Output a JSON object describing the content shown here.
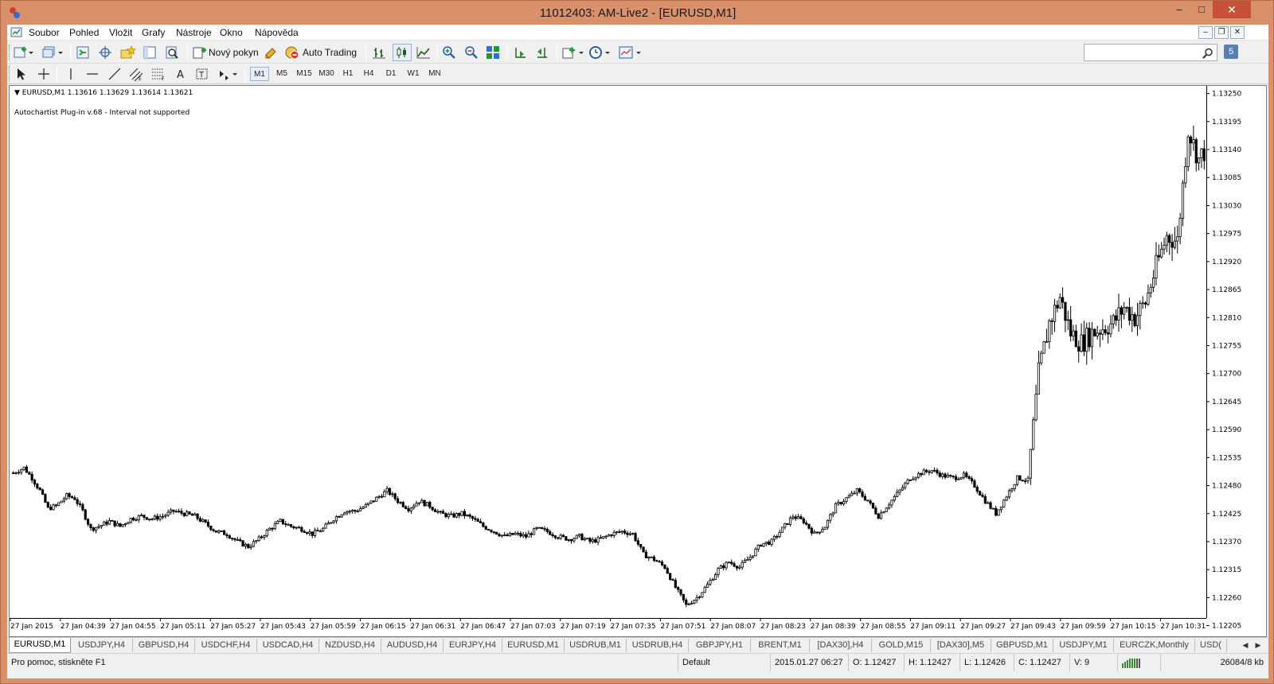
{
  "window": {
    "title": "11012403: AM-Live2 - [EURUSD,M1]",
    "minimize": "–",
    "maximize": "□",
    "close": "✕"
  },
  "menu": {
    "items": [
      "Soubor",
      "Pohled",
      "Vložit",
      "Grafy",
      "Nástroje",
      "Okno",
      "Nápověda"
    ]
  },
  "toolbar": {
    "new_order_label": "Nový pokyn",
    "auto_trading_label": "Auto Trading",
    "search_placeholder": "",
    "notification_count": "5"
  },
  "timeframes": [
    "M1",
    "M5",
    "M15",
    "M30",
    "H1",
    "H4",
    "D1",
    "W1",
    "MN"
  ],
  "active_timeframe": "M1",
  "chart": {
    "symbol_line": "EURUSD,M1  1.13616 1.13629 1.13614 1.13621",
    "plugin_line": "Autochartist Plug-in v.68 - Interval not supported"
  },
  "chart_data": {
    "type": "candlestick",
    "symbol": "EURUSD",
    "timeframe": "M1",
    "ylim": [
      1.1222,
      1.13265
    ],
    "y_ticks": [
      "1.13250",
      "1.13195",
      "1.13140",
      "1.13085",
      "1.13030",
      "1.12975",
      "1.12920",
      "1.12865",
      "1.12810",
      "1.12755",
      "1.12700",
      "1.12645",
      "1.12590",
      "1.12535",
      "1.12480",
      "1.12425",
      "1.12370",
      "1.12315",
      "1.12260",
      "1.12205"
    ],
    "x_ticks": [
      "27 Jan 2015",
      "27 Jan 04:39",
      "27 Jan 04:55",
      "27 Jan 05:11",
      "27 Jan 05:27",
      "27 Jan 05:43",
      "27 Jan 05:59",
      "27 Jan 06:15",
      "27 Jan 06:31",
      "27 Jan 06:47",
      "27 Jan 07:03",
      "27 Jan 07:19",
      "27 Jan 07:35",
      "27 Jan 07:51",
      "27 Jan 08:07",
      "27 Jan 08:23",
      "27 Jan 08:39",
      "27 Jan 08:55",
      "27 Jan 09:11",
      "27 Jan 09:27",
      "27 Jan 09:43",
      "27 Jan 09:59",
      "27 Jan 10:15",
      "27 Jan 10:31"
    ],
    "close_path": [
      [
        0,
        1.12505
      ],
      [
        4,
        1.12515
      ],
      [
        7,
        1.12495
      ],
      [
        10,
        1.1247
      ],
      [
        13,
        1.12435
      ],
      [
        16,
        1.1244
      ],
      [
        20,
        1.1246
      ],
      [
        23,
        1.12455
      ],
      [
        26,
        1.1243
      ],
      [
        29,
        1.12395
      ],
      [
        32,
        1.124
      ],
      [
        36,
        1.1241
      ],
      [
        40,
        1.124
      ],
      [
        44,
        1.12415
      ],
      [
        48,
        1.1242
      ],
      [
        52,
        1.12415
      ],
      [
        56,
        1.1242
      ],
      [
        60,
        1.1243
      ],
      [
        64,
        1.12425
      ],
      [
        68,
        1.1242
      ],
      [
        72,
        1.12405
      ],
      [
        76,
        1.1239
      ],
      [
        80,
        1.12385
      ],
      [
        84,
        1.1237
      ],
      [
        88,
        1.1236
      ],
      [
        92,
        1.12375
      ],
      [
        96,
        1.12395
      ],
      [
        100,
        1.1241
      ],
      [
        104,
        1.124
      ],
      [
        108,
        1.12395
      ],
      [
        112,
        1.12385
      ],
      [
        116,
        1.12395
      ],
      [
        120,
        1.12415
      ],
      [
        124,
        1.1243
      ],
      [
        128,
        1.1243
      ],
      [
        132,
        1.1244
      ],
      [
        136,
        1.12455
      ],
      [
        140,
        1.1247
      ],
      [
        144,
        1.1245
      ],
      [
        148,
        1.12435
      ],
      [
        152,
        1.1245
      ],
      [
        156,
        1.1244
      ],
      [
        160,
        1.12425
      ],
      [
        164,
        1.1242
      ],
      [
        168,
        1.12425
      ],
      [
        172,
        1.12415
      ],
      [
        176,
        1.124
      ],
      [
        180,
        1.1239
      ],
      [
        184,
        1.1238
      ],
      [
        188,
        1.12385
      ],
      [
        192,
        1.1238
      ],
      [
        196,
        1.12395
      ],
      [
        200,
        1.1239
      ],
      [
        204,
        1.1238
      ],
      [
        208,
        1.12375
      ],
      [
        212,
        1.1238
      ],
      [
        216,
        1.1237
      ],
      [
        220,
        1.12375
      ],
      [
        224,
        1.12385
      ],
      [
        228,
        1.1239
      ],
      [
        232,
        1.12385
      ],
      [
        236,
        1.12345
      ],
      [
        240,
        1.12335
      ],
      [
        244,
        1.1232
      ],
      [
        248,
        1.1228
      ],
      [
        252,
        1.12245
      ],
      [
        256,
        1.1226
      ],
      [
        260,
        1.12285
      ],
      [
        264,
        1.12315
      ],
      [
        268,
        1.1233
      ],
      [
        272,
        1.1232
      ],
      [
        276,
        1.1234
      ],
      [
        280,
        1.12365
      ],
      [
        284,
        1.1237
      ],
      [
        288,
        1.12395
      ],
      [
        292,
        1.1242
      ],
      [
        296,
        1.1241
      ],
      [
        300,
        1.12385
      ],
      [
        304,
        1.124
      ],
      [
        308,
        1.1244
      ],
      [
        312,
        1.12455
      ],
      [
        316,
        1.1247
      ],
      [
        320,
        1.1245
      ],
      [
        324,
        1.1242
      ],
      [
        328,
        1.12445
      ],
      [
        332,
        1.1247
      ],
      [
        336,
        1.12495
      ],
      [
        340,
        1.12505
      ],
      [
        344,
        1.1251
      ],
      [
        348,
        1.125
      ],
      [
        352,
        1.12495
      ],
      [
        356,
        1.125
      ],
      [
        360,
        1.1248
      ],
      [
        364,
        1.1245
      ],
      [
        368,
        1.12425
      ],
      [
        372,
        1.1246
      ],
      [
        376,
        1.12495
      ],
      [
        380,
        1.1249
      ],
      [
        384,
        1.127
      ],
      [
        388,
        1.128
      ],
      [
        392,
        1.1285
      ],
      [
        396,
        1.1278
      ],
      [
        400,
        1.1276
      ],
      [
        404,
        1.1278
      ],
      [
        408,
        1.1279
      ],
      [
        412,
        1.128
      ],
      [
        416,
        1.1283
      ],
      [
        420,
        1.1281
      ],
      [
        424,
        1.1284
      ],
      [
        428,
        1.1291
      ],
      [
        432,
        1.1297
      ],
      [
        436,
        1.1296
      ],
      [
        440,
        1.1318
      ],
      [
        444,
        1.1312
      ],
      [
        446,
        1.13135
      ]
    ]
  },
  "tabs": [
    "EURUSD,M1",
    "USDJPY,H4",
    "GBPUSD,H4",
    "USDCHF,H4",
    "USDCAD,H4",
    "NZDUSD,H4",
    "AUDUSD,H4",
    "EURJPY,H4",
    "EURUSD,M1",
    "USDRUB,M1",
    "USDRUB,H4",
    "GBPJPY,H1",
    "BRENT,M1",
    "[DAX30],H4",
    "GOLD,M15",
    "[DAX30],M5",
    "GBPUSD,M1",
    "USDJPY,M1",
    "EURCZK,Monthly",
    "USD("
  ],
  "status": {
    "help": "Pro pomoc, stiskněte F1",
    "profile": "Default",
    "datetime": "2015.01.27 06:27",
    "open": "O: 1.12427",
    "high": "H: 1.12427",
    "low": "L: 1.12426",
    "close": "C: 1.12427",
    "volume": "V: 9",
    "traffic": "26084/8 kb"
  }
}
